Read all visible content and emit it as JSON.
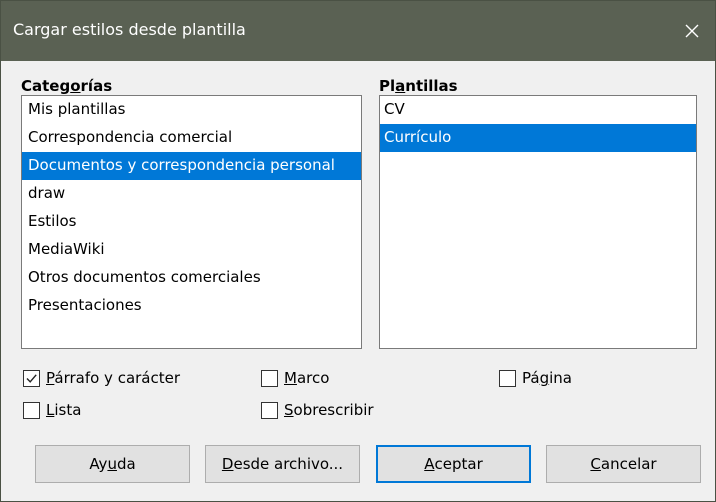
{
  "dialog": {
    "title": "Cargar estilos desde plantilla"
  },
  "categories": {
    "label_pre": "Categ",
    "label_key": "o",
    "label_post": "rías",
    "items": [
      "Mis plantillas",
      "Correspondencia comercial",
      "Documentos y correspondencia personal",
      "draw",
      "Estilos",
      "MediaWiki",
      "Otros documentos comerciales",
      "Presentaciones"
    ],
    "selected_index": 2
  },
  "templates": {
    "label_pre": "Pl",
    "label_key": "a",
    "label_post": "ntillas",
    "items": [
      "CV",
      "Currículo"
    ],
    "selected_index": 1
  },
  "options": {
    "paragraph": {
      "pre": "",
      "key": "P",
      "post": "árrafo y carácter",
      "checked": true
    },
    "frame": {
      "pre": "",
      "key": "M",
      "post": "arco",
      "checked": false
    },
    "page": {
      "pre": "Pá",
      "key": "g",
      "post": "ina",
      "checked": false
    },
    "list": {
      "pre": "",
      "key": "L",
      "post": "ista",
      "checked": false
    },
    "overwrite": {
      "pre": "",
      "key": "S",
      "post": "obrescribir",
      "checked": false
    }
  },
  "buttons": {
    "help": {
      "pre": "Ay",
      "key": "u",
      "post": "da"
    },
    "from_file": {
      "pre": "",
      "key": "D",
      "post": "esde archivo..."
    },
    "accept": {
      "pre": "",
      "key": "A",
      "post": "ceptar"
    },
    "cancel": {
      "pre": "",
      "key": "C",
      "post": "ancelar"
    }
  },
  "colors": {
    "titlebar": "#5a6153",
    "selection": "#0078d7",
    "dialog_bg": "#f0f0f0"
  }
}
